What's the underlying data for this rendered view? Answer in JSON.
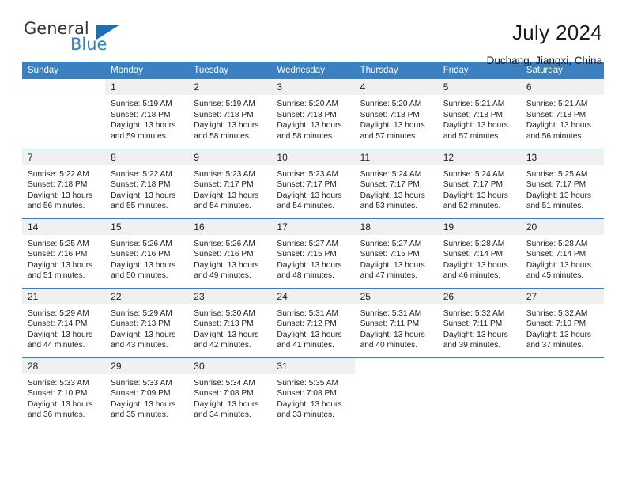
{
  "brand": {
    "name_part1": "General",
    "name_part2": "Blue",
    "triangle_color": "#1f6fb5",
    "blue_color": "#2d82c8"
  },
  "header": {
    "title": "July 2024",
    "subtitle": "Duchang, Jiangxi, China"
  },
  "calendar": {
    "accent_color": "#3b80c0",
    "daynum_background": "#f0f0f0",
    "weekday_headers": [
      "Sunday",
      "Monday",
      "Tuesday",
      "Wednesday",
      "Thursday",
      "Friday",
      "Saturday"
    ],
    "weeks": [
      [
        {
          "day": "",
          "sunrise": "",
          "sunset": "",
          "daylight_line1": "",
          "daylight_line2": ""
        },
        {
          "day": "1",
          "sunrise": "Sunrise: 5:19 AM",
          "sunset": "Sunset: 7:18 PM",
          "daylight_line1": "Daylight: 13 hours",
          "daylight_line2": "and 59 minutes."
        },
        {
          "day": "2",
          "sunrise": "Sunrise: 5:19 AM",
          "sunset": "Sunset: 7:18 PM",
          "daylight_line1": "Daylight: 13 hours",
          "daylight_line2": "and 58 minutes."
        },
        {
          "day": "3",
          "sunrise": "Sunrise: 5:20 AM",
          "sunset": "Sunset: 7:18 PM",
          "daylight_line1": "Daylight: 13 hours",
          "daylight_line2": "and 58 minutes."
        },
        {
          "day": "4",
          "sunrise": "Sunrise: 5:20 AM",
          "sunset": "Sunset: 7:18 PM",
          "daylight_line1": "Daylight: 13 hours",
          "daylight_line2": "and 57 minutes."
        },
        {
          "day": "5",
          "sunrise": "Sunrise: 5:21 AM",
          "sunset": "Sunset: 7:18 PM",
          "daylight_line1": "Daylight: 13 hours",
          "daylight_line2": "and 57 minutes."
        },
        {
          "day": "6",
          "sunrise": "Sunrise: 5:21 AM",
          "sunset": "Sunset: 7:18 PM",
          "daylight_line1": "Daylight: 13 hours",
          "daylight_line2": "and 56 minutes."
        }
      ],
      [
        {
          "day": "7",
          "sunrise": "Sunrise: 5:22 AM",
          "sunset": "Sunset: 7:18 PM",
          "daylight_line1": "Daylight: 13 hours",
          "daylight_line2": "and 56 minutes."
        },
        {
          "day": "8",
          "sunrise": "Sunrise: 5:22 AM",
          "sunset": "Sunset: 7:18 PM",
          "daylight_line1": "Daylight: 13 hours",
          "daylight_line2": "and 55 minutes."
        },
        {
          "day": "9",
          "sunrise": "Sunrise: 5:23 AM",
          "sunset": "Sunset: 7:17 PM",
          "daylight_line1": "Daylight: 13 hours",
          "daylight_line2": "and 54 minutes."
        },
        {
          "day": "10",
          "sunrise": "Sunrise: 5:23 AM",
          "sunset": "Sunset: 7:17 PM",
          "daylight_line1": "Daylight: 13 hours",
          "daylight_line2": "and 54 minutes."
        },
        {
          "day": "11",
          "sunrise": "Sunrise: 5:24 AM",
          "sunset": "Sunset: 7:17 PM",
          "daylight_line1": "Daylight: 13 hours",
          "daylight_line2": "and 53 minutes."
        },
        {
          "day": "12",
          "sunrise": "Sunrise: 5:24 AM",
          "sunset": "Sunset: 7:17 PM",
          "daylight_line1": "Daylight: 13 hours",
          "daylight_line2": "and 52 minutes."
        },
        {
          "day": "13",
          "sunrise": "Sunrise: 5:25 AM",
          "sunset": "Sunset: 7:17 PM",
          "daylight_line1": "Daylight: 13 hours",
          "daylight_line2": "and 51 minutes."
        }
      ],
      [
        {
          "day": "14",
          "sunrise": "Sunrise: 5:25 AM",
          "sunset": "Sunset: 7:16 PM",
          "daylight_line1": "Daylight: 13 hours",
          "daylight_line2": "and 51 minutes."
        },
        {
          "day": "15",
          "sunrise": "Sunrise: 5:26 AM",
          "sunset": "Sunset: 7:16 PM",
          "daylight_line1": "Daylight: 13 hours",
          "daylight_line2": "and 50 minutes."
        },
        {
          "day": "16",
          "sunrise": "Sunrise: 5:26 AM",
          "sunset": "Sunset: 7:16 PM",
          "daylight_line1": "Daylight: 13 hours",
          "daylight_line2": "and 49 minutes."
        },
        {
          "day": "17",
          "sunrise": "Sunrise: 5:27 AM",
          "sunset": "Sunset: 7:15 PM",
          "daylight_line1": "Daylight: 13 hours",
          "daylight_line2": "and 48 minutes."
        },
        {
          "day": "18",
          "sunrise": "Sunrise: 5:27 AM",
          "sunset": "Sunset: 7:15 PM",
          "daylight_line1": "Daylight: 13 hours",
          "daylight_line2": "and 47 minutes."
        },
        {
          "day": "19",
          "sunrise": "Sunrise: 5:28 AM",
          "sunset": "Sunset: 7:14 PM",
          "daylight_line1": "Daylight: 13 hours",
          "daylight_line2": "and 46 minutes."
        },
        {
          "day": "20",
          "sunrise": "Sunrise: 5:28 AM",
          "sunset": "Sunset: 7:14 PM",
          "daylight_line1": "Daylight: 13 hours",
          "daylight_line2": "and 45 minutes."
        }
      ],
      [
        {
          "day": "21",
          "sunrise": "Sunrise: 5:29 AM",
          "sunset": "Sunset: 7:14 PM",
          "daylight_line1": "Daylight: 13 hours",
          "daylight_line2": "and 44 minutes."
        },
        {
          "day": "22",
          "sunrise": "Sunrise: 5:29 AM",
          "sunset": "Sunset: 7:13 PM",
          "daylight_line1": "Daylight: 13 hours",
          "daylight_line2": "and 43 minutes."
        },
        {
          "day": "23",
          "sunrise": "Sunrise: 5:30 AM",
          "sunset": "Sunset: 7:13 PM",
          "daylight_line1": "Daylight: 13 hours",
          "daylight_line2": "and 42 minutes."
        },
        {
          "day": "24",
          "sunrise": "Sunrise: 5:31 AM",
          "sunset": "Sunset: 7:12 PM",
          "daylight_line1": "Daylight: 13 hours",
          "daylight_line2": "and 41 minutes."
        },
        {
          "day": "25",
          "sunrise": "Sunrise: 5:31 AM",
          "sunset": "Sunset: 7:11 PM",
          "daylight_line1": "Daylight: 13 hours",
          "daylight_line2": "and 40 minutes."
        },
        {
          "day": "26",
          "sunrise": "Sunrise: 5:32 AM",
          "sunset": "Sunset: 7:11 PM",
          "daylight_line1": "Daylight: 13 hours",
          "daylight_line2": "and 39 minutes."
        },
        {
          "day": "27",
          "sunrise": "Sunrise: 5:32 AM",
          "sunset": "Sunset: 7:10 PM",
          "daylight_line1": "Daylight: 13 hours",
          "daylight_line2": "and 37 minutes."
        }
      ],
      [
        {
          "day": "28",
          "sunrise": "Sunrise: 5:33 AM",
          "sunset": "Sunset: 7:10 PM",
          "daylight_line1": "Daylight: 13 hours",
          "daylight_line2": "and 36 minutes."
        },
        {
          "day": "29",
          "sunrise": "Sunrise: 5:33 AM",
          "sunset": "Sunset: 7:09 PM",
          "daylight_line1": "Daylight: 13 hours",
          "daylight_line2": "and 35 minutes."
        },
        {
          "day": "30",
          "sunrise": "Sunrise: 5:34 AM",
          "sunset": "Sunset: 7:08 PM",
          "daylight_line1": "Daylight: 13 hours",
          "daylight_line2": "and 34 minutes."
        },
        {
          "day": "31",
          "sunrise": "Sunrise: 5:35 AM",
          "sunset": "Sunset: 7:08 PM",
          "daylight_line1": "Daylight: 13 hours",
          "daylight_line2": "and 33 minutes."
        },
        {
          "day": "",
          "sunrise": "",
          "sunset": "",
          "daylight_line1": "",
          "daylight_line2": ""
        },
        {
          "day": "",
          "sunrise": "",
          "sunset": "",
          "daylight_line1": "",
          "daylight_line2": ""
        },
        {
          "day": "",
          "sunrise": "",
          "sunset": "",
          "daylight_line1": "",
          "daylight_line2": ""
        }
      ]
    ]
  }
}
